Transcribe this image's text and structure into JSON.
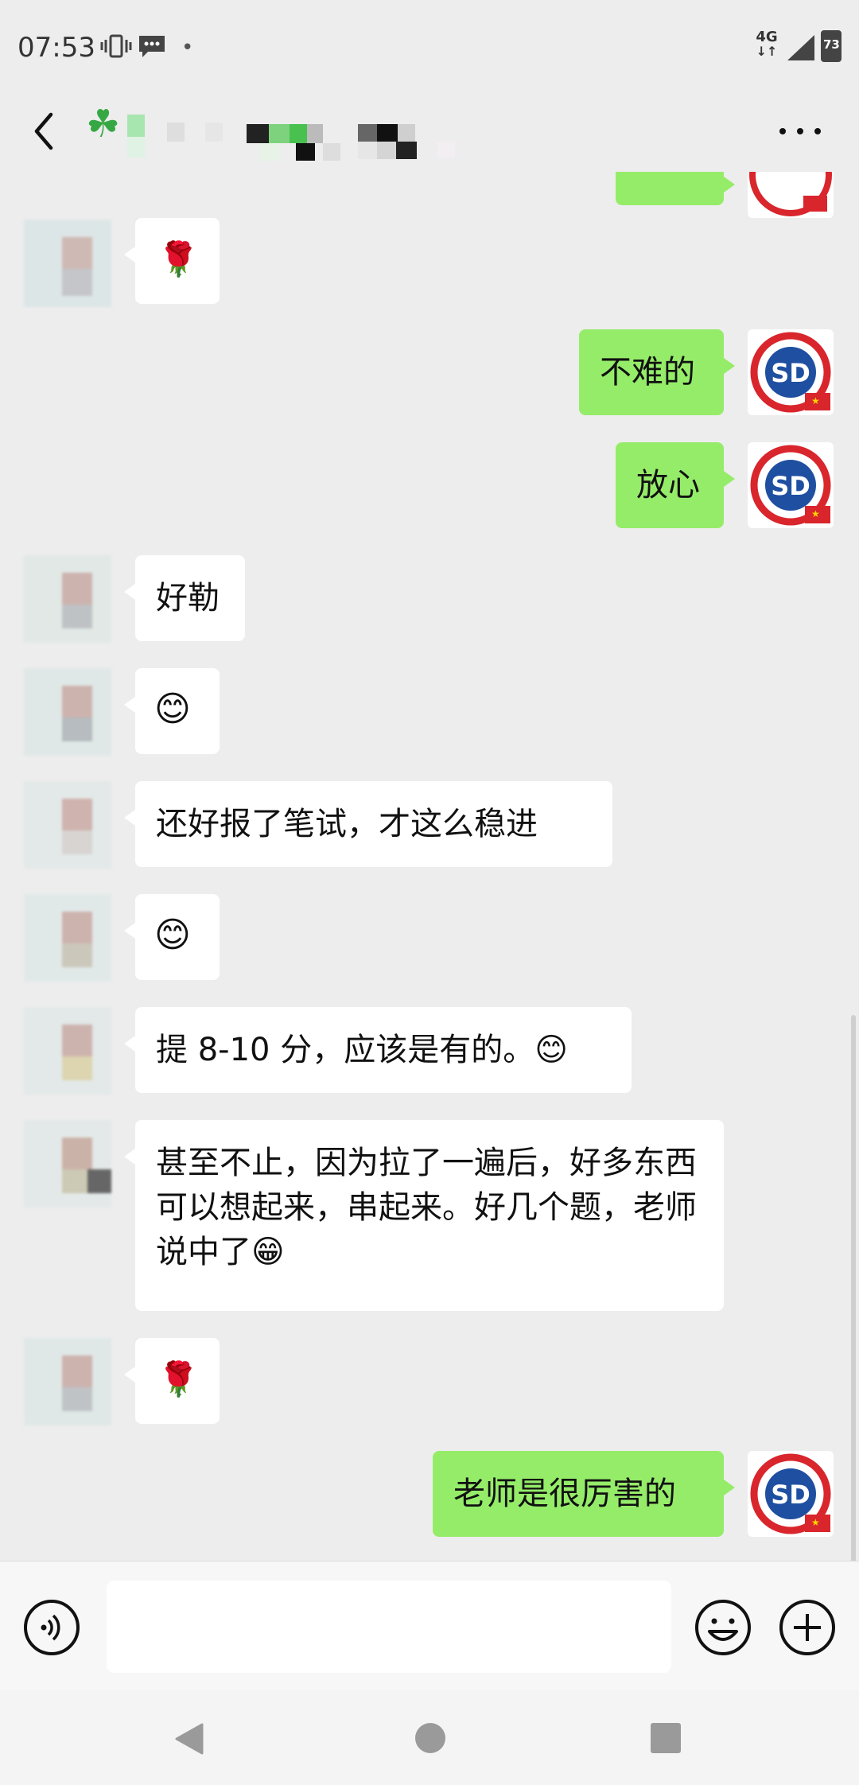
{
  "status_bar": {
    "time": "07:53",
    "network": "4G",
    "battery": "73",
    "icons": [
      "vibrate-icon",
      "message-icon",
      "signal-icon",
      "battery-icon"
    ]
  },
  "header": {
    "back_icon": "chevron-left-icon",
    "prefix_icon": "clover-icon",
    "prefix_glyph": "☘",
    "more_icon": "more-icon"
  },
  "messages": [
    {
      "dir": "in",
      "type": "emoji",
      "text": "🌹"
    },
    {
      "dir": "out",
      "type": "text",
      "text": "不难的"
    },
    {
      "dir": "out",
      "type": "text",
      "text": "放心"
    },
    {
      "dir": "in",
      "type": "text",
      "text": "好勒"
    },
    {
      "dir": "in",
      "type": "emoji",
      "text": "😊"
    },
    {
      "dir": "in",
      "type": "text",
      "text": "还好报了笔试，才这么稳进"
    },
    {
      "dir": "in",
      "type": "emoji",
      "text": "😊"
    },
    {
      "dir": "in",
      "type": "text",
      "text": "提 8-10 分，应该是有的。😊"
    },
    {
      "dir": "in",
      "type": "text",
      "text": "甚至不止，因为拉了一遍后，好多东西可以想起来，串起来。好几个题，老师说中了😁"
    },
    {
      "dir": "in",
      "type": "emoji",
      "text": "🌹"
    },
    {
      "dir": "out",
      "type": "text",
      "text": "老师是很厉害的"
    }
  ],
  "input_bar": {
    "voice_icon": "voice-icon",
    "input_value": "",
    "emoji_icon": "emoji-icon",
    "plus_icon": "plus-icon"
  },
  "nav_bar": {
    "icons": [
      "nav-back-icon",
      "nav-home-icon",
      "nav-recent-icon"
    ]
  },
  "colors": {
    "background": "#ededed",
    "outgoing_bubble": "#95ec69",
    "incoming_bubble": "#ffffff",
    "logo_red": "#d9252c",
    "logo_blue": "#1f4fa0"
  }
}
